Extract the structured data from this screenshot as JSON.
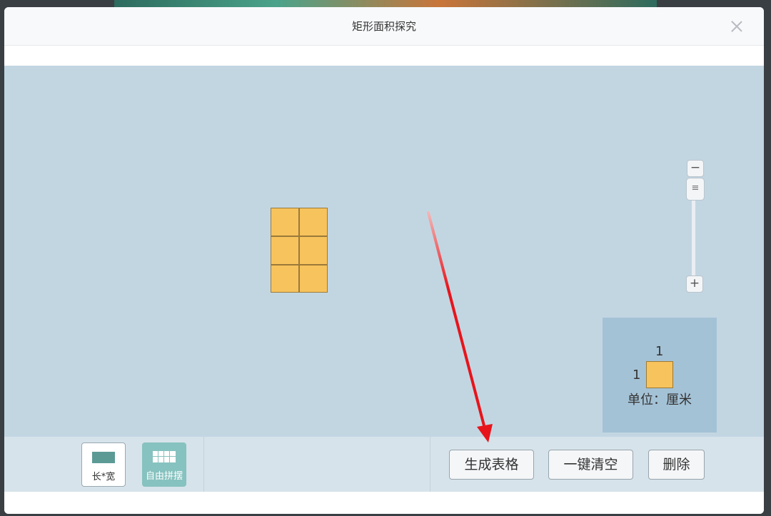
{
  "dialog": {
    "title": "矩形面积探究"
  },
  "zoom": {
    "minus": "−",
    "plus": "+",
    "handle": "≡"
  },
  "unit_panel": {
    "top_value": "1",
    "left_value": "1",
    "label": "单位：厘米"
  },
  "shape": {
    "columns": 2,
    "rows": 3
  },
  "toolbar": {
    "mode_length_width": "长*宽",
    "mode_free_tiling": "自由拼摆",
    "generate_table": "生成表格",
    "clear_all": "一键清空",
    "delete": "删除"
  },
  "colors": {
    "tile": "#f7c35c",
    "canvas": "#c2d6e2",
    "annotation_arrow": "#e8141b"
  },
  "annotation": {
    "arrow_target": "toolbar.generate_table"
  }
}
